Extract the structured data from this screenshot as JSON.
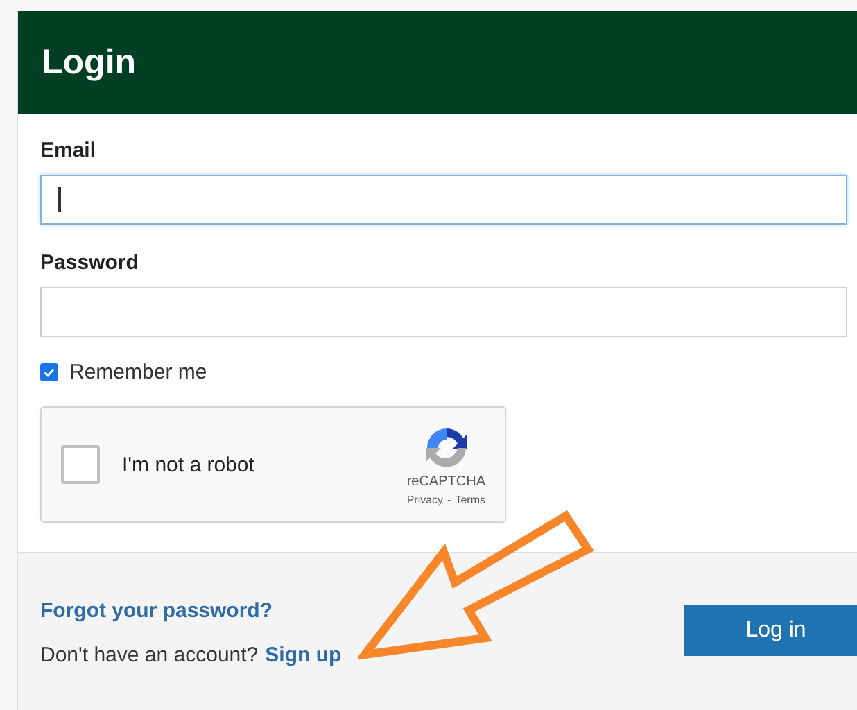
{
  "header": {
    "title": "Login"
  },
  "fields": [
    {
      "label": "Email",
      "focused": true
    },
    {
      "label": "Password",
      "focused": false
    }
  ],
  "remember": {
    "label": "Remember me",
    "checked": true
  },
  "captcha": {
    "label": "I'm not a robot",
    "checked": false,
    "brand": "reCAPTCHA",
    "privacy": "Privacy",
    "separator": "-",
    "terms": "Terms"
  },
  "footer": {
    "forgot_link": "Forgot your password?",
    "signup_prompt": "Don't have an account?",
    "signup_link": "Sign up",
    "login_button": "Log in"
  }
}
